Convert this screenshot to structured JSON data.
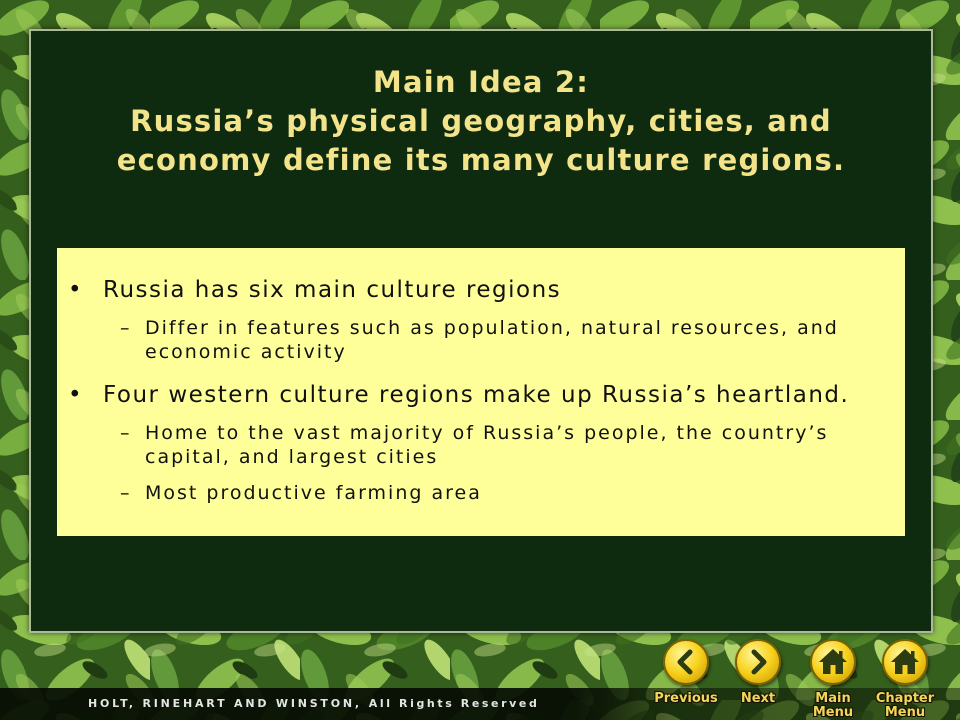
{
  "slide": {
    "title": [
      "Main Idea 2:",
      "Russia’s physical geography, cities, and",
      "economy define its many culture regions."
    ]
  },
  "content": {
    "bullet_marker": "•",
    "sub_marker": "–",
    "bullets": [
      {
        "text": "Russia has six main culture regions",
        "sub": [
          "Differ in features such as population, natural resources, and economic activity"
        ]
      },
      {
        "text": "Four western culture regions make up Russia’s heartland.",
        "sub": [
          "Home to the vast majority of Russia’s people, the country’s capital, and largest cities",
          "Most productive farming area"
        ]
      }
    ]
  },
  "nav": {
    "previous": {
      "label": "Previous",
      "icon": "chevron-left-icon"
    },
    "next": {
      "label": "Next",
      "icon": "chevron-right-icon"
    },
    "main_menu": {
      "label": "Main Menu",
      "icon": "home-icon"
    },
    "chapter_menu": {
      "label": "Chapter Menu",
      "icon": "home-icon"
    }
  },
  "footer": {
    "publisher": "HOLT, RINEHART AND WINSTON,",
    "rights": "All Rights Reserved"
  },
  "colors": {
    "background_leaves": "#4e8a2a",
    "panel": "#0e2b10",
    "title": "#f3e48c",
    "content_box": "#ffff99",
    "content_text": "#111111",
    "nav_button": "#f7d21e",
    "nav_icon": "#2c3b12",
    "nav_label": "#f2d55a",
    "footer_text": "#e4e4e4"
  }
}
